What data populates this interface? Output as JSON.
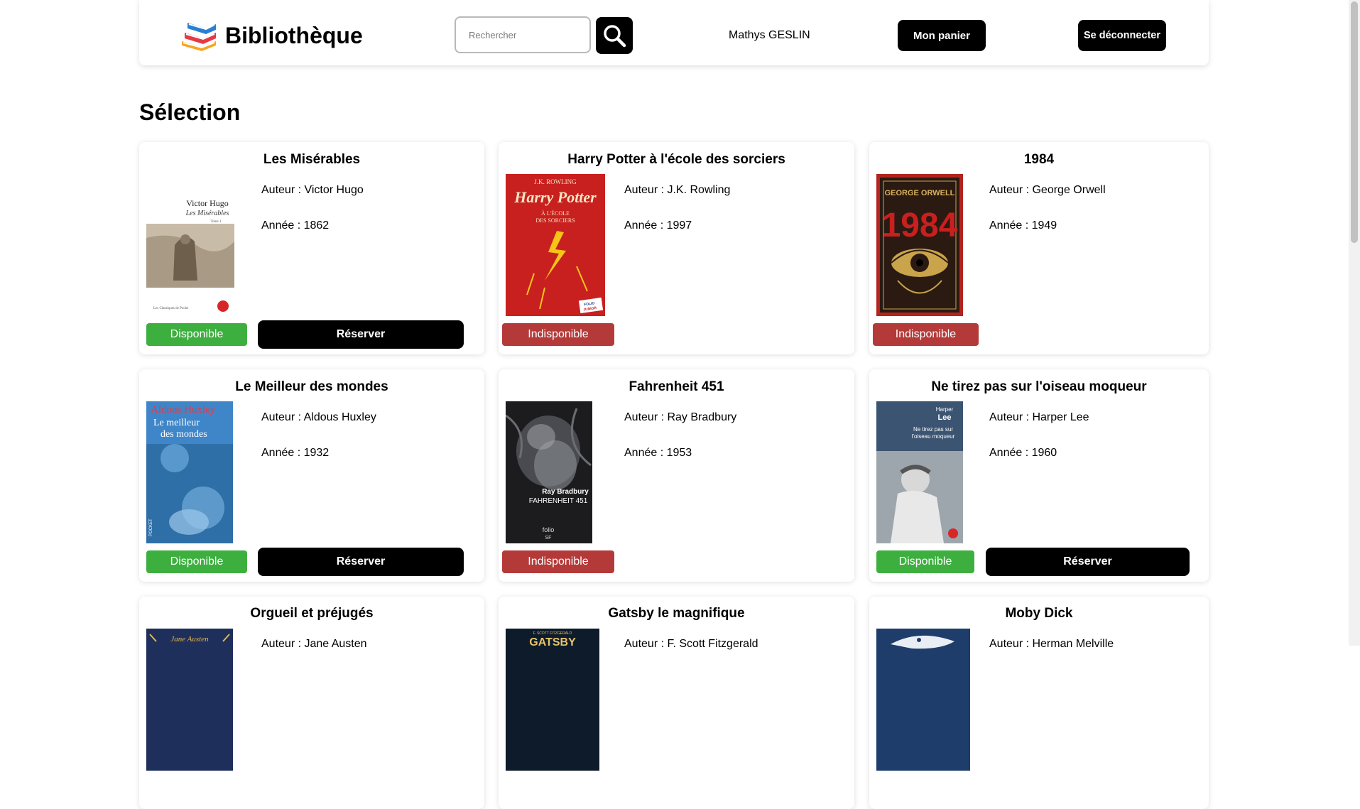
{
  "header": {
    "brand": "Bibliothèque",
    "search_placeholder": "Rechercher",
    "user_name": "Mathys GESLIN",
    "cart_label": "Mon panier",
    "logout_label": "Se déconnecter"
  },
  "section_title": "Sélection",
  "books": [
    {
      "title": "Les Misérables",
      "author": "Auteur : Victor Hugo",
      "year": "Année : 1862",
      "status": "Disponible",
      "reserve": "Réserver"
    },
    {
      "title": "Harry Potter à l'école des sorciers",
      "author": "Auteur : J.K. Rowling",
      "year": "Année : 1997",
      "status": "Indisponible"
    },
    {
      "title": "1984",
      "author": "Auteur : George Orwell",
      "year": "Année : 1949",
      "status": "Indisponible"
    },
    {
      "title": "Le Meilleur des mondes",
      "author": "Auteur : Aldous Huxley",
      "year": "Année : 1932",
      "status": "Disponible",
      "reserve": "Réserver"
    },
    {
      "title": "Fahrenheit 451",
      "author": "Auteur : Ray Bradbury",
      "year": "Année : 1953",
      "status": "Indisponible"
    },
    {
      "title": "Ne tirez pas sur l'oiseau moqueur",
      "author": "Auteur : Harper Lee",
      "year": "Année : 1960",
      "status": "Disponible",
      "reserve": "Réserver"
    },
    {
      "title": "Orgueil et préjugés",
      "author": "Auteur : Jane Austen"
    },
    {
      "title": "Gatsby le magnifique",
      "author": "Auteur : F. Scott Fitzgerald"
    },
    {
      "title": "Moby Dick",
      "author": "Auteur : Herman Melville"
    }
  ],
  "covers": {
    "hugo": {
      "line1": "Victor Hugo",
      "line2": "Les Misérables",
      "line3": "Tome 1",
      "footer": "Les Classiques de Poche"
    },
    "potter": {
      "author": "J.K. ROWLING",
      "title": "Harry Potter",
      "sub1": "À L'ÉCOLE",
      "sub2": "DES SORCIERS",
      "badge1": "FOLIO",
      "badge2": "JUNIOR"
    },
    "orwell": {
      "author": "GEORGE ORWELL",
      "title": "1984"
    },
    "huxley": {
      "line1": "Aldous Huxley",
      "line2": "Le meilleur",
      "line3": "des mondes",
      "spine": "POCKET"
    },
    "bradbury": {
      "line1": "Ray Bradbury",
      "line2": "FAHRENHEIT 451",
      "footer": "folio",
      "footer2": "SF"
    },
    "lee": {
      "line1": "Harper",
      "line2": "Lee",
      "line3": "Ne tirez pas sur",
      "line4": "l'oiseau moqueur"
    },
    "austen": {
      "line1": "Jane Austen"
    },
    "gatsby": {
      "line1": "F. SCOTT FITZGERALD",
      "line2": "GATSBY"
    }
  },
  "colors": {
    "available": "#3daf3f",
    "unavailable": "#b43a3a",
    "button": "#000000"
  },
  "icons": {
    "logo": "books-stack-icon",
    "search": "search-icon"
  }
}
